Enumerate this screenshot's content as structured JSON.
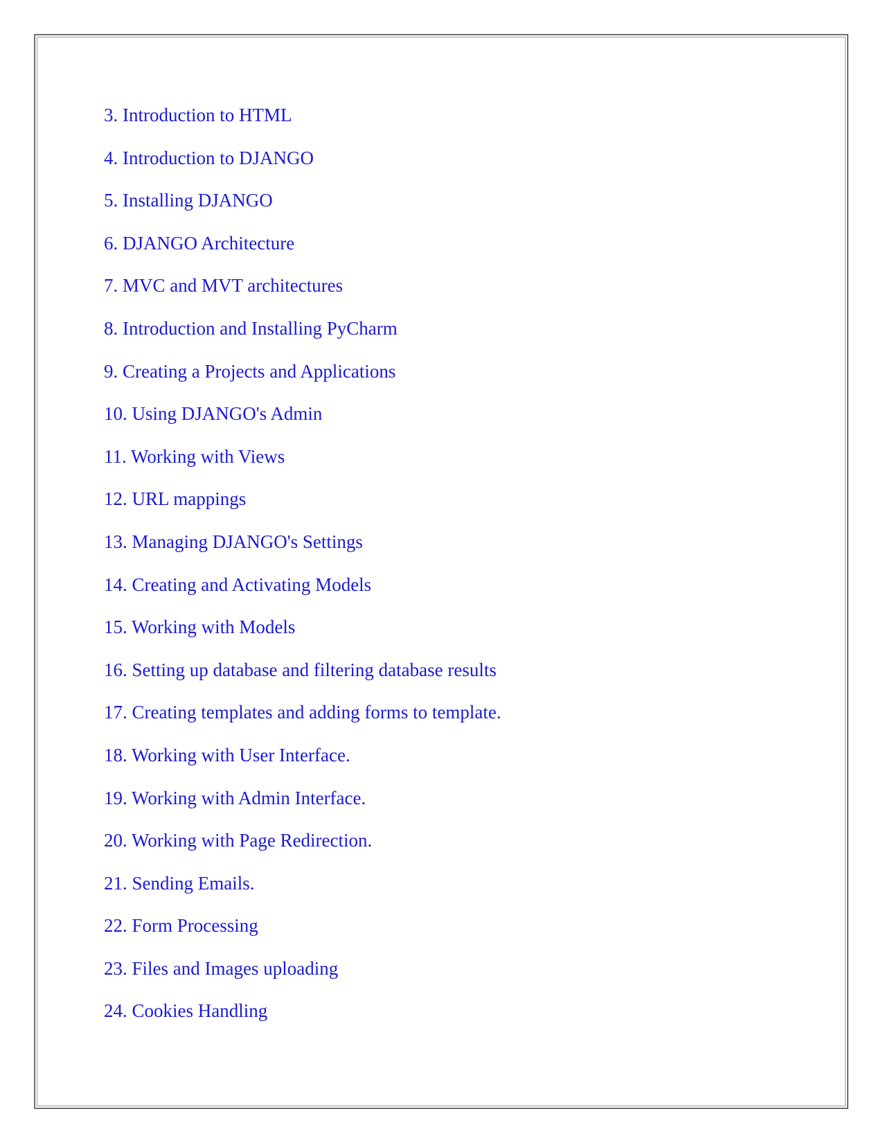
{
  "toc": {
    "items": [
      "3. Introduction to HTML",
      "4. Introduction to DJANGO",
      "5. Installing DJANGO",
      "6. DJANGO Architecture",
      "7. MVC and MVT architectures",
      "8. Introduction and Installing PyCharm",
      "9. Creating a Projects and Applications",
      "10. Using DJANGO's Admin",
      "11. Working with Views",
      "12. URL mappings",
      "13. Managing DJANGO's Settings",
      "14. Creating and Activating Models",
      "15. Working with Models",
      "16. Setting up database and filtering database results",
      "17. Creating templates and adding forms to template.",
      "18. Working with User Interface.",
      "19. Working with Admin Interface.",
      "20. Working with Page Redirection.",
      "21. Sending Emails.",
      "22. Form Processing",
      "23. Files and Images uploading",
      "24. Cookies Handling"
    ],
    "link_color": "#1b1bd1"
  }
}
